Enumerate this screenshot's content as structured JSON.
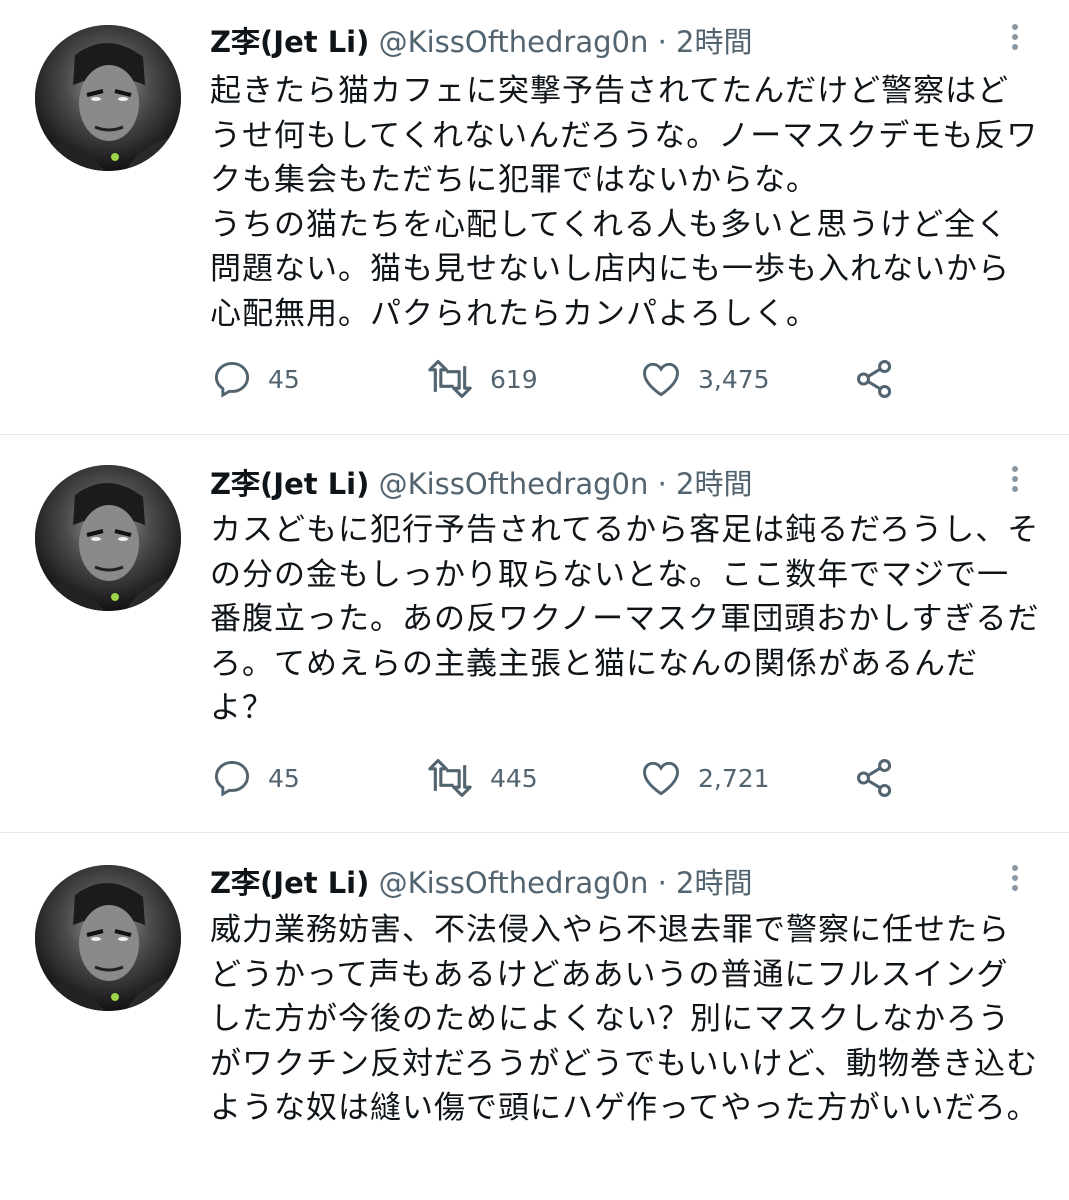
{
  "tweets": [
    {
      "display_name": "Z李(Jet Li)",
      "handle": "@KissOfthedrag0n",
      "separator": "·",
      "time": "2時間",
      "text": "起きたら猫カフェに突撃予告されてたんだけど警察はどうせ何もしてくれないんだろうな。ノーマスクデモも反ワクも集会もただちに犯罪ではないからな。\nうちの猫たちを心配してくれる人も多いと思うけど全く問題ない。猫も見せないし店内にも一歩も入れないから心配無用。パクられたらカンパよろしく。",
      "replies": "45",
      "retweets": "619",
      "likes": "3,475"
    },
    {
      "display_name": "Z李(Jet Li)",
      "handle": "@KissOfthedrag0n",
      "separator": "·",
      "time": "2時間",
      "text": "カスどもに犯行予告されてるから客足は鈍るだろうし、その分の金もしっかり取らないとな。ここ数年でマジで一番腹立った。あの反ワクノーマスク軍団頭おかしすぎるだろ。てめえらの主義主張と猫になんの関係があるんだよ？",
      "replies": "45",
      "retweets": "445",
      "likes": "2,721"
    },
    {
      "display_name": "Z李(Jet Li)",
      "handle": "@KissOfthedrag0n",
      "separator": "·",
      "time": "2時間",
      "text": "威力業務妨害、不法侵入やら不退去罪で警察に任せたらどうかって声もあるけどああいうの普通にフルスイングした方が今後のためによくない？別にマスクしなかろうがワクチン反対だろうがどうでもいいけど、動物巻き込むような奴は縫い傷で頭にハゲ作ってやった方がいいだろ。"
    }
  ],
  "icons": {
    "reply": "speech-bubble-icon",
    "retweet": "retweet-arrows-icon",
    "like": "heart-icon",
    "share": "share-nodes-icon",
    "more": "vertical-dots-icon"
  },
  "colors": {
    "text": "#0f1419",
    "secondary": "#536471",
    "divider": "#e4e8eb"
  }
}
